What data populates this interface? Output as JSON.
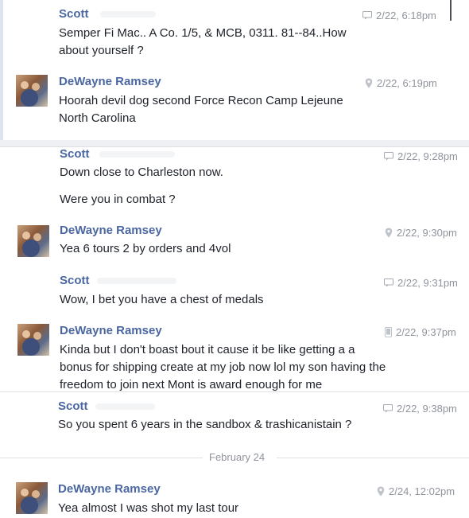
{
  "messages": [
    {
      "sender": "Scott",
      "time": "2/22, 6:18pm",
      "icon": "chat-icon",
      "lines": [
        "Semper Fi Mac.. A Co. 1/5, & MCB, 0311. 81--84..How",
        "about yourself ?"
      ]
    },
    {
      "sender": "DeWayne Ramsey",
      "time": "2/22, 6:19pm",
      "icon": "location-icon",
      "lines": [
        "Hoorah devil dog second Force Recon Camp Lejeune",
        "North Carolina"
      ]
    },
    {
      "sender": "Scott",
      "time": "2/22, 9:28pm",
      "icon": "chat-icon",
      "lines": [
        "Down close to Charleston now.",
        "Were you in combat ?"
      ]
    },
    {
      "sender": "DeWayne Ramsey",
      "time": "2/22, 9:30pm",
      "icon": "location-icon",
      "lines": [
        "Yea 6 tours 2 by orders and  4vol"
      ]
    },
    {
      "sender": "Scott",
      "time": "2/22, 9:31pm",
      "icon": "chat-icon",
      "lines": [
        "Wow, I bet you have a chest of medals"
      ]
    },
    {
      "sender": "DeWayne Ramsey",
      "time": "2/22, 9:37pm",
      "icon": "mobile-icon",
      "lines": [
        "Kinda but I don't boast bout  it cause it be like getting a a",
        "bonus for shipping create at my job now lol my son having the",
        "freedom to join next Mont is award enough for me"
      ]
    },
    {
      "sender": "Scott",
      "time": "2/22, 9:38pm",
      "icon": "chat-icon",
      "lines": [
        "So you spent 6 years in the sandbox & trashicanistain ?"
      ]
    },
    {
      "sender": "DeWayne Ramsey",
      "time": "2/24, 12:02pm",
      "icon": "location-icon",
      "lines": [
        "Yea almost I was shot my last tour"
      ]
    }
  ],
  "date_divider": "February 24",
  "colors": {
    "name": "#4b67a1",
    "text": "#1d2129",
    "meta": "#90949c"
  }
}
